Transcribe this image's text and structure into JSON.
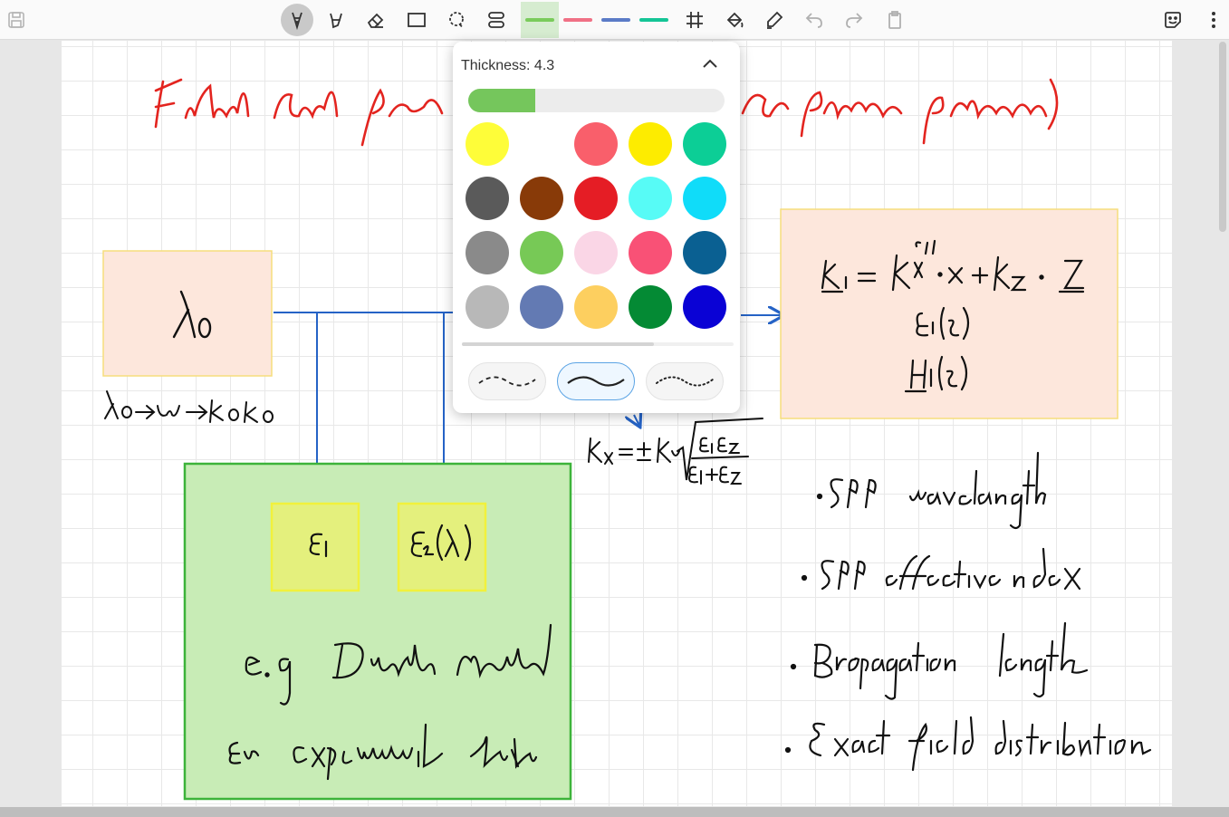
{
  "toolbar": {
    "icons": [
      "save-icon",
      "pen-icon",
      "highlighter-icon",
      "eraser-icon",
      "rectangle-icon",
      "lasso-icon",
      "layers-icon",
      "grid-icon",
      "fill-icon",
      "marker-icon",
      "undo-icon",
      "redo-icon",
      "clipboard-icon",
      "sticker-icon",
      "more-icon"
    ],
    "pen_colors": [
      "#7acb5b",
      "#f07085",
      "#5b7bc7",
      "#14c596"
    ],
    "active_tool": "pen-icon"
  },
  "popup": {
    "thickness_label": "Thickness: 4.3",
    "thickness_fraction": 0.26,
    "palette": [
      "#fefd39",
      "#ffffff",
      "#f95f6b",
      "#fdec00",
      "#0cce96",
      "#5a5a5a",
      "#883a08",
      "#e51d25",
      "#57fbf6",
      "#10dcf9",
      "#8a8a8a",
      "#77c956",
      "#fad6e6",
      "#f95176",
      "#0a6092",
      "#b8b8b8",
      "#637ab3",
      "#fdcf5f",
      "#048a34",
      "#0a02d5"
    ],
    "line_styles": [
      "dashed",
      "solid",
      "dotted"
    ],
    "selected_style": "solid"
  },
  "colors": {
    "accent": "#75c65c",
    "box_peach": "#fde7dc",
    "box_green": "#c8ecb6",
    "box_yellow": "#e4f07d",
    "arrow_blue": "#2563c6",
    "ink_red": "#e3241f"
  }
}
